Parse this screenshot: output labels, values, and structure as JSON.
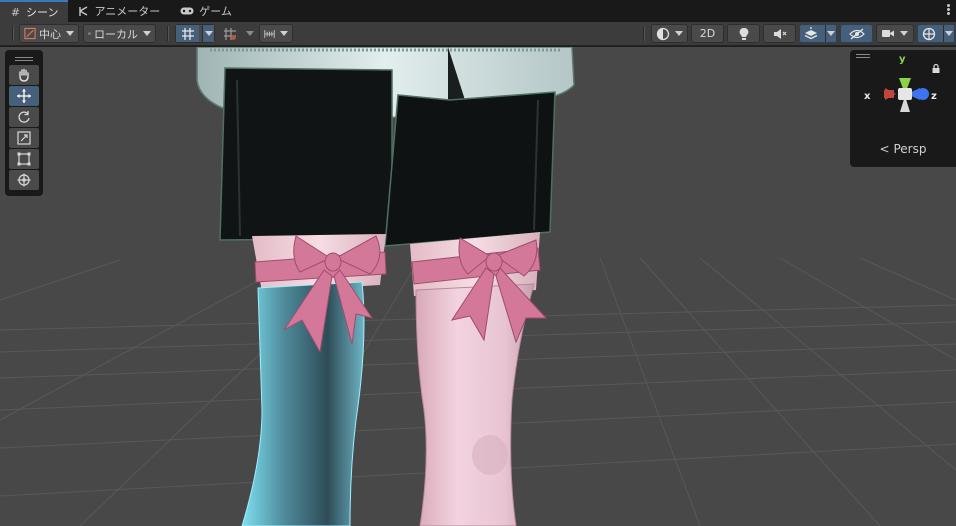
{
  "tabs": [
    {
      "label": "シーン",
      "icon": "grid-icon",
      "active": true
    },
    {
      "label": "アニメーター",
      "icon": "animator-icon",
      "active": false
    },
    {
      "label": "ゲーム",
      "icon": "gamepad-icon",
      "active": false
    }
  ],
  "toolbar": {
    "pivot_label": "中心",
    "space_label": "ローカル",
    "mode_2d_label": "2D"
  },
  "gizmo": {
    "y_label": "y",
    "x_label": "x",
    "z_label": "z",
    "projection_label": "Persp"
  },
  "colors": {
    "active_tab_accent": "#3a79bb",
    "active_button": "#46607c",
    "axis_x": "#c0453a",
    "axis_y": "#8cd347",
    "axis_z": "#3c74f0",
    "ribbon_pink": "#d4789a"
  }
}
